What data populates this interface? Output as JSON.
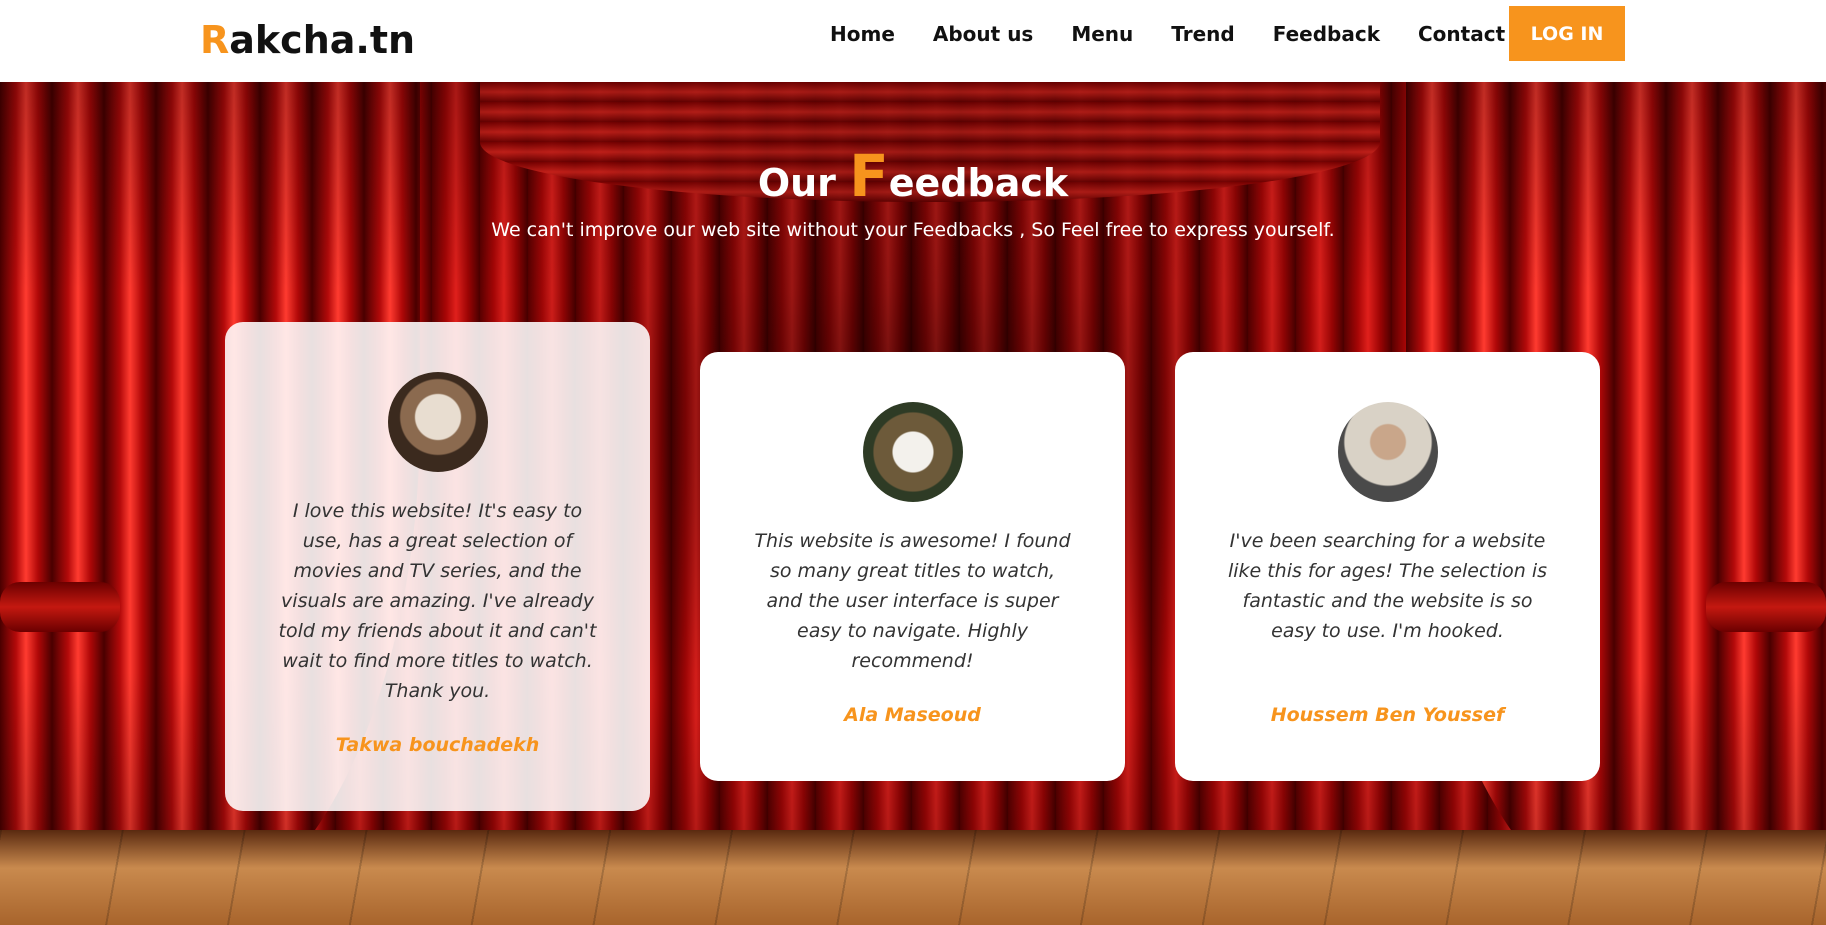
{
  "brand": {
    "first_letter": "R",
    "rest": "akcha.tn"
  },
  "nav": {
    "links": [
      "Home",
      "About us",
      "Menu",
      "Trend",
      "Feedback",
      "Contact"
    ],
    "login_label": "LOG IN"
  },
  "section": {
    "title_prefix": "Our ",
    "title_initial": "F",
    "title_rest": "eedback",
    "subtitle": "We can't improve our web site without your Feedbacks , So Feel free to express yourself."
  },
  "testimonials": [
    {
      "quote": "I love this website! It's easy to use, has a great selection of movies and TV series, and the visuals are amazing. I've already told my friends about it and can't wait to find more titles to watch. Thank you.",
      "author": "Takwa bouchadekh"
    },
    {
      "quote": "This website is awesome! I found so many great titles to watch, and the user interface is super easy to navigate. Highly recommend!",
      "author": "Ala Maseoud"
    },
    {
      "quote": "I've been searching for a website like this for ages! The selection is fantastic and the website is so easy to use. I'm hooked.",
      "author": "Houssem Ben Youssef"
    }
  ],
  "colors": {
    "accent": "#f7941d",
    "navbar_bg": "#ffffff",
    "curtain": "#c41810"
  }
}
